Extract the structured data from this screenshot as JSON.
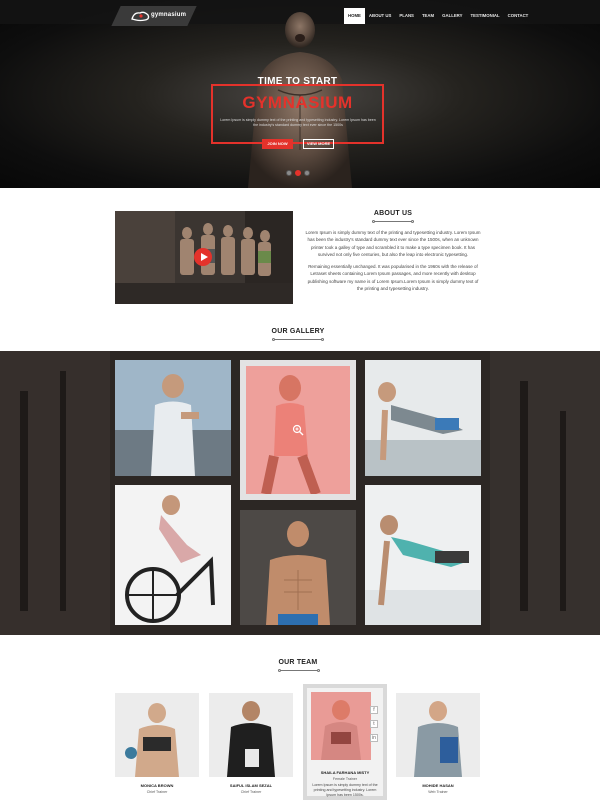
{
  "brand": {
    "logo_text": "gymnasium"
  },
  "nav": {
    "items": [
      {
        "label": "HOME",
        "active": true
      },
      {
        "label": "ABOUT US",
        "active": false
      },
      {
        "label": "PLANS",
        "active": false
      },
      {
        "label": "TEAM",
        "active": false
      },
      {
        "label": "GALLERY",
        "active": false
      },
      {
        "label": "TESTIMONIAL",
        "active": false
      },
      {
        "label": "CONTACT",
        "active": false
      }
    ]
  },
  "hero": {
    "subtitle": "TIME TO START",
    "title": "GYMNASIUM",
    "description": "Lorem Ipsum is simply dummy text of the printing and typesetting industry. Lorem Ipsum has been the industry's standard dummy text ever since the 1500s",
    "join_label": "JOIN NOW",
    "view_label": "VIEW MORE",
    "slides": 3,
    "active_slide": 2
  },
  "about": {
    "title": "ABOUT US",
    "paragraph1": "Lorem Ipsum is simply dummy text of the printing and typesetting industry. Lorem Ipsum has been the industry's standard dummy text ever since the 1500s, when an unknown printer took a galley of type and scrambled it to make a type specimen book. It has survived not only five centuries, but also the leap into electronic typesetting.",
    "paragraph2": "Remaining essentially unchanged. It was popularised in the 1960s with the release of Letraset sheets containing Lorem Ipsum passages, and more recently with desktop publishing software my name is of Lorem Ipsum.Lorem Ipsum is simply dummy text of the printing and typesetting industry."
  },
  "gallery": {
    "title": "OUR GALLERY"
  },
  "team": {
    "title": "OUR TEAM",
    "members": [
      {
        "name": "MONICA BROWN",
        "role": "Chief Trainer"
      },
      {
        "name": "SAIFUL ISLAM SEZAL",
        "role": "Chief Trainer"
      },
      {
        "name": "SHAILA FARHANA MISTY",
        "role": "Female Trainer",
        "bio": "Lorem Ipsum is simply dummy text of the printing and typesetting industry. Lorem Ipsum has been 1500s."
      },
      {
        "name": "MOHIDE HASAN",
        "role": "Web Trainer"
      }
    ]
  },
  "colors": {
    "accent": "#e4322b",
    "dark": "#0e0e0e"
  }
}
